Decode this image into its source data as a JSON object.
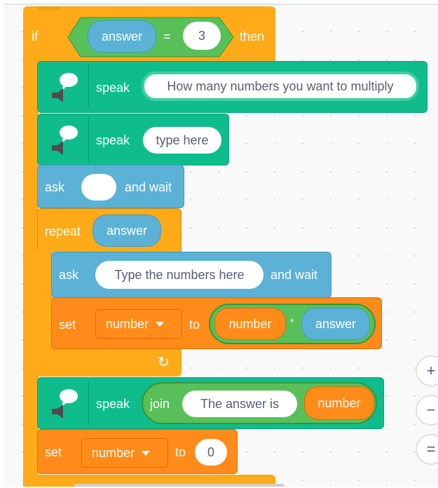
{
  "blocks": {
    "if_block": {
      "if_label": "if",
      "then_label": "then",
      "condition": {
        "left": "answer",
        "operator": "=",
        "right": "3"
      }
    },
    "speak1": {
      "label": "speak",
      "text": "How many numbers you want to multiply"
    },
    "speak2": {
      "label": "speak",
      "text": "type here"
    },
    "ask1": {
      "label": "ask",
      "input": "",
      "suffix": "and wait"
    },
    "repeat": {
      "label": "repeat",
      "times": "answer"
    },
    "ask2": {
      "label": "ask",
      "input": "Type the numbers here",
      "suffix": "and wait"
    },
    "set1": {
      "label": "set",
      "variable": "number",
      "to_label": "to",
      "left": "number",
      "operator": "*",
      "right": "answer"
    },
    "repeat_arrow": "↻",
    "speak3": {
      "label": "speak",
      "join_label": "join",
      "text": "The answer is",
      "value": "number"
    },
    "set2": {
      "label": "set",
      "variable": "number",
      "to_label": "to",
      "value": "0"
    }
  },
  "zoom_controls": {
    "zoom_in": "+",
    "zoom_out": "−",
    "reset": "="
  },
  "colors": {
    "control": "#ffab19",
    "text2speech": "#0fbd8c",
    "sensing": "#5cb1d6",
    "variables": "#ff8c1a",
    "operators": "#59c059"
  }
}
